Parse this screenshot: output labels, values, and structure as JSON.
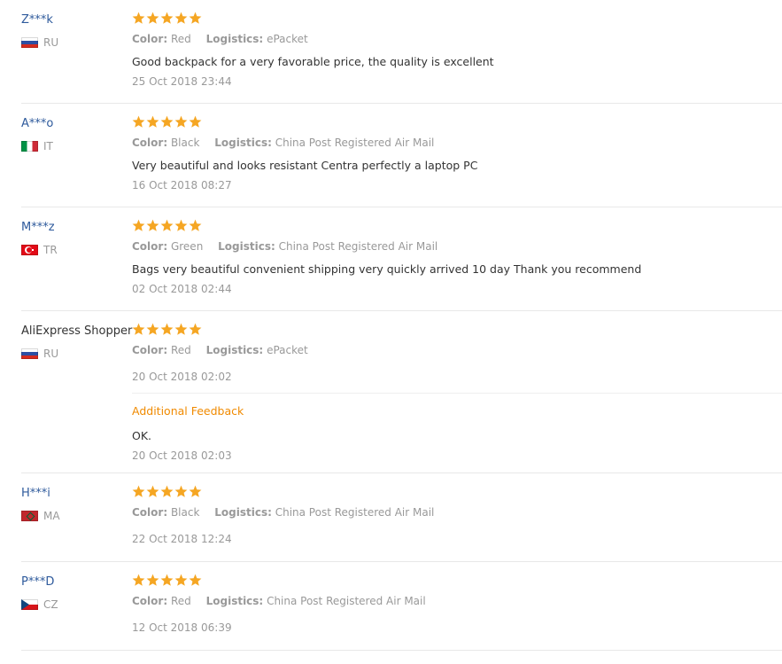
{
  "labels": {
    "color": "Color:",
    "logistics": "Logistics:",
    "additional_feedback": "Additional Feedback"
  },
  "colors": {
    "star": "#f5a623",
    "username_link": "#2e5a9c",
    "accent_orange": "#f08a00",
    "muted_text": "#999999"
  },
  "reviews": [
    {
      "user": "Z***k",
      "country": "RU",
      "flag": "russia-flag",
      "stars": 5,
      "color": "Red",
      "logistics": "ePacket",
      "comment": "Good backpack for a very favorable price, the quality is excellent",
      "date": "25 Oct 2018 23:44"
    },
    {
      "user": "A***o",
      "country": "IT",
      "flag": "italy-flag",
      "stars": 5,
      "color": "Black",
      "logistics": "China Post Registered Air Mail",
      "comment": "Very beautiful and looks resistant Centra perfectly a laptop PC",
      "date": "16 Oct 2018 08:27"
    },
    {
      "user": "M***z",
      "country": "TR",
      "flag": "turkey-flag",
      "stars": 5,
      "color": "Green",
      "logistics": "China Post Registered Air Mail",
      "comment": "Bags very beautiful convenient shipping very quickly arrived 10 day Thank you recommend",
      "date": "02 Oct 2018 02:44"
    },
    {
      "user": "AliExpress Shopper",
      "country": "RU",
      "flag": "russia-flag",
      "stars": 5,
      "color": "Red",
      "logistics": "ePacket",
      "comment": "",
      "date": "20 Oct 2018 02:02",
      "additional_feedback": {
        "comment": "OK.",
        "date": "20 Oct 2018 02:03"
      }
    },
    {
      "user": "H***i",
      "country": "MA",
      "flag": "morocco-flag",
      "stars": 5,
      "color": "Black",
      "logistics": "China Post Registered Air Mail",
      "comment": "",
      "date": "22 Oct 2018 12:24"
    },
    {
      "user": "P***D",
      "country": "CZ",
      "flag": "czech-flag",
      "stars": 5,
      "color": "Red",
      "logistics": "China Post Registered Air Mail",
      "comment": "",
      "date": "12 Oct 2018 06:39"
    }
  ]
}
